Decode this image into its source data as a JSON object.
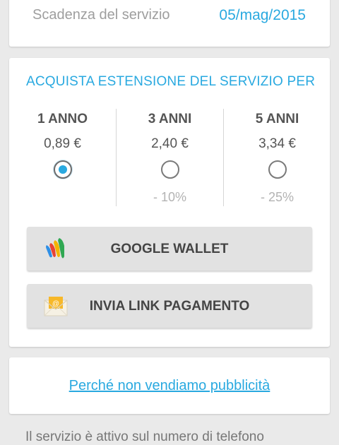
{
  "expiry": {
    "label": "Scadenza del servizio",
    "value": "05/mag/2015"
  },
  "purchase": {
    "title": "ACQUISTA ESTENSIONE DEL SERVIZIO PER",
    "plans": [
      {
        "name": "1 ANNO",
        "price": "0,89 €",
        "selected": true,
        "discount": ""
      },
      {
        "name": "3 ANNI",
        "price": "2,40 €",
        "selected": false,
        "discount": "- 10%"
      },
      {
        "name": "5 ANNI",
        "price": "3,34 €",
        "selected": false,
        "discount": "- 25%"
      }
    ],
    "buttons": {
      "wallet": {
        "label": "GOOGLE WALLET",
        "icon": "google-wallet-icon"
      },
      "link": {
        "label": "INVIA LINK PAGAMENTO",
        "icon": "email-at-icon"
      }
    }
  },
  "info_link": {
    "label": "Perché non vendiamo pubblicità"
  },
  "footer": {
    "text": "Il servizio è attivo sul numero di telefono"
  },
  "colors": {
    "accent": "#29a9e0",
    "background": "#eaeaea",
    "card": "#ffffff",
    "button": "#e2e2e2"
  }
}
